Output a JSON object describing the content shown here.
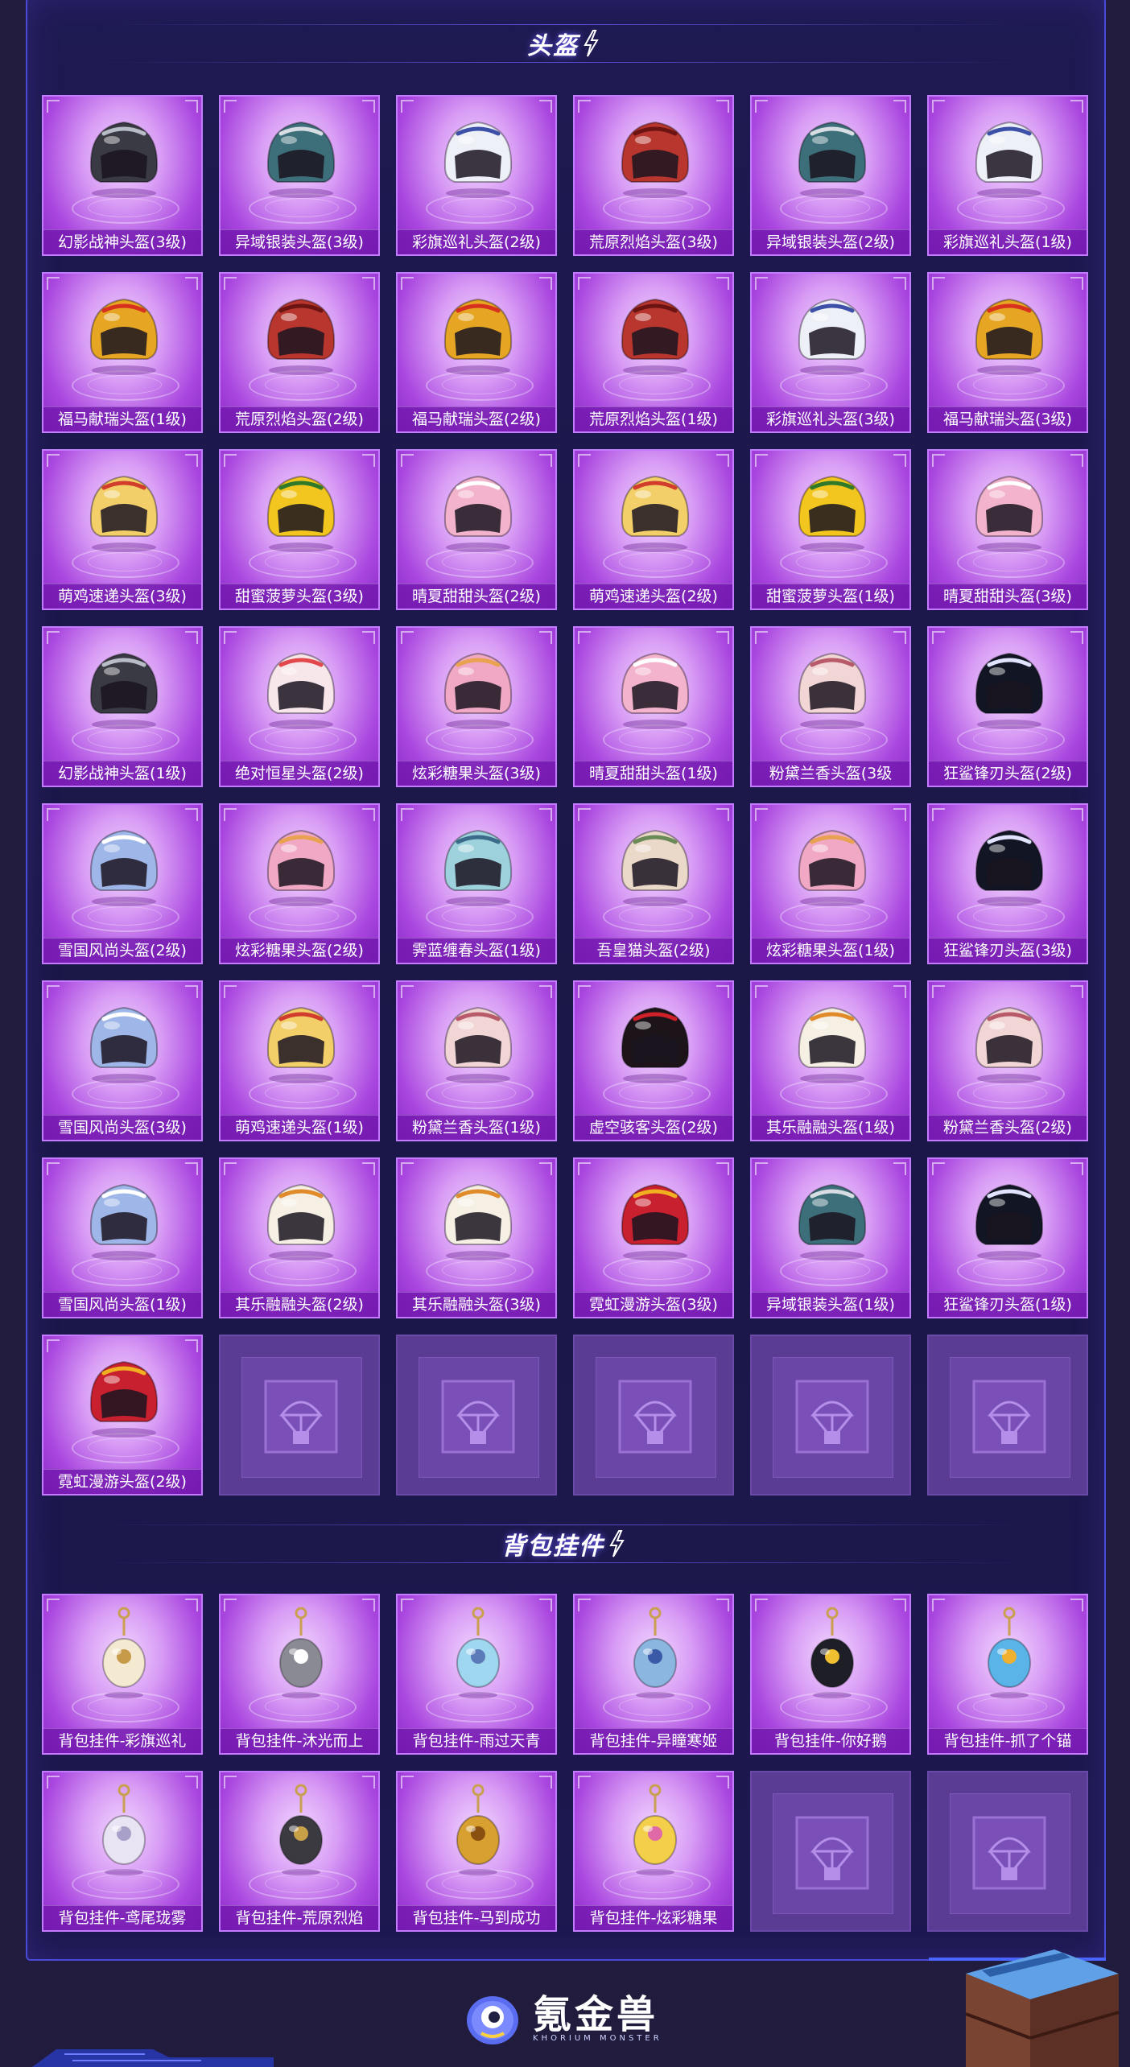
{
  "sections": {
    "helmets_title": "头盔",
    "charms_title": "背包挂件"
  },
  "helmets": [
    {
      "label": "幻影战神头盔(3级)",
      "icon": "black-silver-helmet",
      "color": "#3a3a44",
      "accent": "#b8bcc6"
    },
    {
      "label": "异域银装头盔(3级)",
      "icon": "teal-silver-helmet",
      "color": "#3d6f7a",
      "accent": "#d7dde3"
    },
    {
      "label": "彩旗巡礼头盔(2级)",
      "icon": "white-blue-floral-helmet",
      "color": "#eef0f8",
      "accent": "#3c50a8"
    },
    {
      "label": "荒原烈焰头盔(3级)",
      "icon": "red-flame-helmet",
      "color": "#b8362e",
      "accent": "#6b1412"
    },
    {
      "label": "异域银装头盔(2级)",
      "icon": "teal-silver-helmet",
      "color": "#3d6f7a",
      "accent": "#d7dde3"
    },
    {
      "label": "彩旗巡礼头盔(1级)",
      "icon": "white-blue-floral-helmet",
      "color": "#eef0f8",
      "accent": "#3c50a8"
    },
    {
      "label": "福马献瑞头盔(1级)",
      "icon": "golden-horse-helmet",
      "color": "#e6a623",
      "accent": "#d8321f"
    },
    {
      "label": "荒原烈焰头盔(2级)",
      "icon": "red-flame-helmet",
      "color": "#b8362e",
      "accent": "#6b1412"
    },
    {
      "label": "福马献瑞头盔(2级)",
      "icon": "golden-horse-helmet",
      "color": "#e6a623",
      "accent": "#d8321f"
    },
    {
      "label": "荒原烈焰头盔(1级)",
      "icon": "red-flame-helmet",
      "color": "#b8362e",
      "accent": "#6b1412"
    },
    {
      "label": "彩旗巡礼头盔(3级)",
      "icon": "white-blue-floral-helmet",
      "color": "#eef0f8",
      "accent": "#3c50a8"
    },
    {
      "label": "福马献瑞头盔(3级)",
      "icon": "golden-horse-helmet",
      "color": "#e6a623",
      "accent": "#d8321f"
    },
    {
      "label": "萌鸡速递头盔(3级)",
      "icon": "yellow-chick-helmet",
      "color": "#f3cf6a",
      "accent": "#d23c2c"
    },
    {
      "label": "甜蜜菠萝头盔(3级)",
      "icon": "pineapple-helmet",
      "color": "#f2c51f",
      "accent": "#2e7a2a"
    },
    {
      "label": "晴夏甜甜头盔(2级)",
      "icon": "pink-sweet-helmet",
      "color": "#f4b3cc",
      "accent": "#ffffff"
    },
    {
      "label": "萌鸡速递头盔(2级)",
      "icon": "yellow-chick-helmet",
      "color": "#f3cf6a",
      "accent": "#d23c2c"
    },
    {
      "label": "甜蜜菠萝头盔(1级)",
      "icon": "pineapple-helmet",
      "color": "#f2c51f",
      "accent": "#2e7a2a"
    },
    {
      "label": "晴夏甜甜头盔(3级)",
      "icon": "pink-sweet-helmet",
      "color": "#f4b3cc",
      "accent": "#ffffff"
    },
    {
      "label": "幻影战神头盔(1级)",
      "icon": "black-silver-helmet",
      "color": "#3a3a44",
      "accent": "#b8bcc6"
    },
    {
      "label": "绝对恒星头盔(2级)",
      "icon": "white-star-helmet",
      "color": "#f7e6ea",
      "accent": "#e2474b"
    },
    {
      "label": "炫彩糖果头盔(3级)",
      "icon": "candy-helmet",
      "color": "#f0a8c4",
      "accent": "#e8a250"
    },
    {
      "label": "晴夏甜甜头盔(1级)",
      "icon": "pink-sweet-helmet",
      "color": "#f4b3cc",
      "accent": "#ffffff"
    },
    {
      "label": "粉黛兰香头盔(3级",
      "icon": "pink-orchid-helmet",
      "color": "#f2d6d6",
      "accent": "#b85a6a"
    },
    {
      "label": "狂鲨锋刃头盔(2级)",
      "icon": "black-shark-helmet",
      "color": "#121624",
      "accent": "#e0e4ff"
    },
    {
      "label": "雪国风尚头盔(2级)",
      "icon": "snow-blue-helmet",
      "color": "#9fb6e8",
      "accent": "#ffffff"
    },
    {
      "label": "炫彩糖果头盔(2级)",
      "icon": "candy-helmet",
      "color": "#f0a8c4",
      "accent": "#e8a250"
    },
    {
      "label": "霁蓝缠春头盔(1级)",
      "icon": "teal-floral-helmet",
      "color": "#9dd2dd",
      "accent": "#3c6a8a"
    },
    {
      "label": "吾皇猫头盔(2级)",
      "icon": "cat-helmet",
      "color": "#ead8c8",
      "accent": "#6a8a58"
    },
    {
      "label": "炫彩糖果头盔(1级)",
      "icon": "candy-helmet",
      "color": "#f0a8c4",
      "accent": "#e8a250"
    },
    {
      "label": "狂鲨锋刃头盔(3级)",
      "icon": "black-shark-helmet",
      "color": "#121624",
      "accent": "#e0e4ff"
    },
    {
      "label": "雪国风尚头盔(3级)",
      "icon": "snow-blue-helmet",
      "color": "#9fb6e8",
      "accent": "#ffffff"
    },
    {
      "label": "萌鸡速递头盔(1级)",
      "icon": "yellow-chick-helmet",
      "color": "#f3cf6a",
      "accent": "#d23c2c"
    },
    {
      "label": "粉黛兰香头盔(1级)",
      "icon": "pink-orchid-helmet",
      "color": "#f2d6d6",
      "accent": "#b85a6a"
    },
    {
      "label": "虚空骇客头盔(2级)",
      "icon": "void-hacker-helmet",
      "color": "#1c1418",
      "accent": "#d0202a"
    },
    {
      "label": "其乐融融头盔(1级)",
      "icon": "cream-gold-helmet",
      "color": "#f6efe4",
      "accent": "#e08a2a"
    },
    {
      "label": "粉黛兰香头盔(2级)",
      "icon": "pink-orchid-helmet",
      "color": "#f2d6d6",
      "accent": "#b85a6a"
    },
    {
      "label": "雪国风尚头盔(1级)",
      "icon": "snow-blue-helmet",
      "color": "#9fb6e8",
      "accent": "#ffffff"
    },
    {
      "label": "其乐融融头盔(2级)",
      "icon": "cream-gold-helmet",
      "color": "#f6efe4",
      "accent": "#e08a2a"
    },
    {
      "label": "其乐融融头盔(3级)",
      "icon": "cream-gold-helmet",
      "color": "#f6efe4",
      "accent": "#e08a2a"
    },
    {
      "label": "霓虹漫游头盔(3级)",
      "icon": "neon-red-helmet",
      "color": "#c8202e",
      "accent": "#f0b020"
    },
    {
      "label": "异域银装头盔(1级)",
      "icon": "teal-silver-helmet",
      "color": "#3d6f7a",
      "accent": "#d7dde3"
    },
    {
      "label": "狂鲨锋刃头盔(1级)",
      "icon": "black-shark-helmet",
      "color": "#121624",
      "accent": "#e0e4ff"
    },
    {
      "label": "霓虹漫游头盔(2级)",
      "icon": "neon-red-helmet",
      "color": "#c8202e",
      "accent": "#f0b020"
    }
  ],
  "helmet_empty_slots": 5,
  "charms": [
    {
      "label": "背包挂件-彩旗巡礼",
      "icon": "ice-cream-charm",
      "color": "#f4ead2",
      "accent": "#c79a4a"
    },
    {
      "label": "背包挂件-沐光而上",
      "icon": "cat-charm",
      "color": "#8a8a94",
      "accent": "#ffffff"
    },
    {
      "label": "背包挂件-雨过天青",
      "icon": "blue-sword-charm",
      "color": "#9fd6f0",
      "accent": "#5a7ab8"
    },
    {
      "label": "背包挂件-异瞳寒姬",
      "icon": "ice-bell-charm",
      "color": "#8ab6e0",
      "accent": "#3a5aa8"
    },
    {
      "label": "背包挂件-你好鹅",
      "icon": "penguin-charm",
      "color": "#1e1e26",
      "accent": "#f0c030"
    },
    {
      "label": "背包挂件-抓了个锚",
      "icon": "anchor-charm",
      "color": "#5ab4e8",
      "accent": "#f0b030"
    },
    {
      "label": "背包挂件-鸢尾珑雾",
      "icon": "butterfly-charm",
      "color": "#e8e4f4",
      "accent": "#a8a0c8"
    },
    {
      "label": "背包挂件-荒原烈焰",
      "icon": "sun-charm",
      "color": "#3a3a40",
      "accent": "#c8a048"
    },
    {
      "label": "背包挂件-马到成功",
      "icon": "golden-horse-charm",
      "color": "#d8a030",
      "accent": "#8a5010"
    },
    {
      "label": "背包挂件-炫彩糖果",
      "icon": "candy-wand-charm",
      "color": "#f4d04a",
      "accent": "#e06aa8"
    }
  ],
  "charm_empty_slots": 2,
  "footer": {
    "brand_name": "氪金兽",
    "brand_sub": "KHORIUM MONSTER",
    "brand_icon": "blue-monster-logo",
    "crate_icon": "airdrop-crate-icon"
  },
  "colors": {
    "frame_border": "#4a4ad8",
    "card_border": "#c37bff",
    "empty_slot": "#5a3c95"
  }
}
